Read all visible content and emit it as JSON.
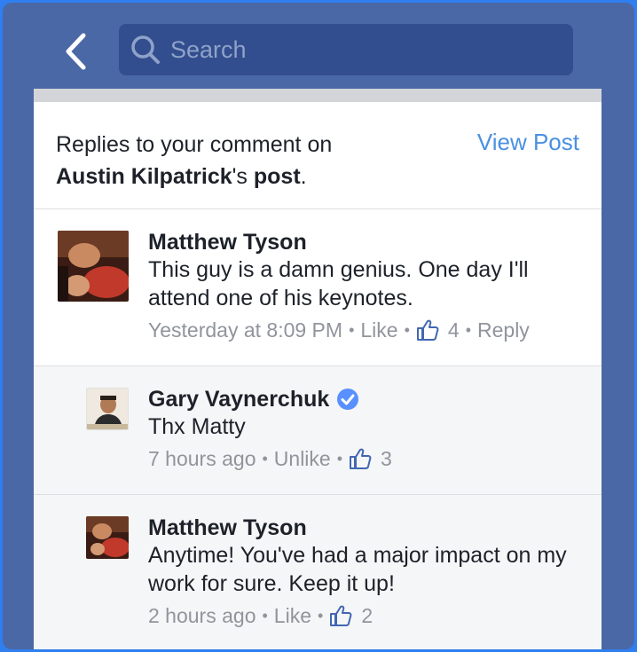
{
  "nav": {
    "search_placeholder": "Search"
  },
  "header": {
    "prefix": "Replies to your comment on",
    "author": "Austin Kilpatrick",
    "possessive": "'s ",
    "post_word": "post",
    "period": ".",
    "view_post_label": "View Post"
  },
  "comments": [
    {
      "name": "Matthew Tyson",
      "text": "This guy is a damn genius. One day I'll attend one of his keynotes.",
      "time": "Yesterday at 8:09 PM",
      "like_label": "Like",
      "like_count": "4",
      "reply_label": "Reply"
    },
    {
      "name": "Gary Vaynerchuk",
      "verified": true,
      "text": "Thx Matty",
      "time": "7 hours ago",
      "like_label": "Unlike",
      "like_count": "3"
    },
    {
      "name": "Matthew Tyson",
      "text": "Anytime! You've had a major impact on my work for sure. Keep it up!",
      "time": "2 hours ago",
      "like_label": "Like",
      "like_count": "2"
    }
  ],
  "colors": {
    "nav_bg": "#4b68a6",
    "search_bg": "#334e8e",
    "link": "#4a90e2",
    "like_thumb": "#4267b2",
    "verified": "#5890ff"
  }
}
